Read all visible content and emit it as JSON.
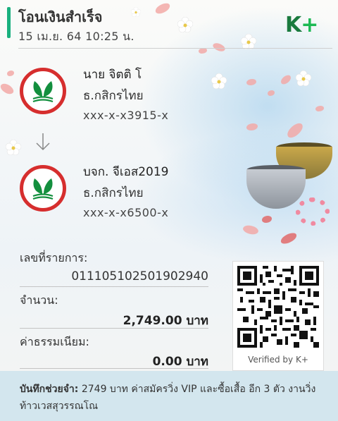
{
  "header": {
    "title": "โอนเงินสำเร็จ",
    "datetime": "15 เม.ย. 64  10:25 น.",
    "brand_k": "K",
    "brand_plus": "+"
  },
  "sender": {
    "name": "นาย จิตติ โ",
    "bank": "ธ.กสิกรไทย",
    "account": "xxx-x-x3915-x"
  },
  "receiver": {
    "name": "บจก. จีเอส2019",
    "bank": "ธ.กสิกรไทย",
    "account": "xxx-x-x6500-x"
  },
  "details": {
    "ref_label": "เลขที่รายการ:",
    "ref_value": "011105102501902940",
    "amount_label": "จำนวน:",
    "amount_value": "2,749.00 บาท",
    "fee_label": "ค่าธรรมเนียม:",
    "fee_value": "0.00 บาท"
  },
  "qr": {
    "caption": "Verified by K+"
  },
  "memo": {
    "label": "บันทึกช่วยจำ:",
    "text": " 2749 บาท ค่าสมัครวิ่ง VIP และซื้อเสื้อ อีก 3 ตัว งานวิ่งท้าวเวสสุวรรณโณ"
  },
  "colors": {
    "accent_green": "#19b07e",
    "kbank_red": "#d62e2e",
    "kbank_green": "#138f3e",
    "memo_band": "#d3e6ee"
  }
}
